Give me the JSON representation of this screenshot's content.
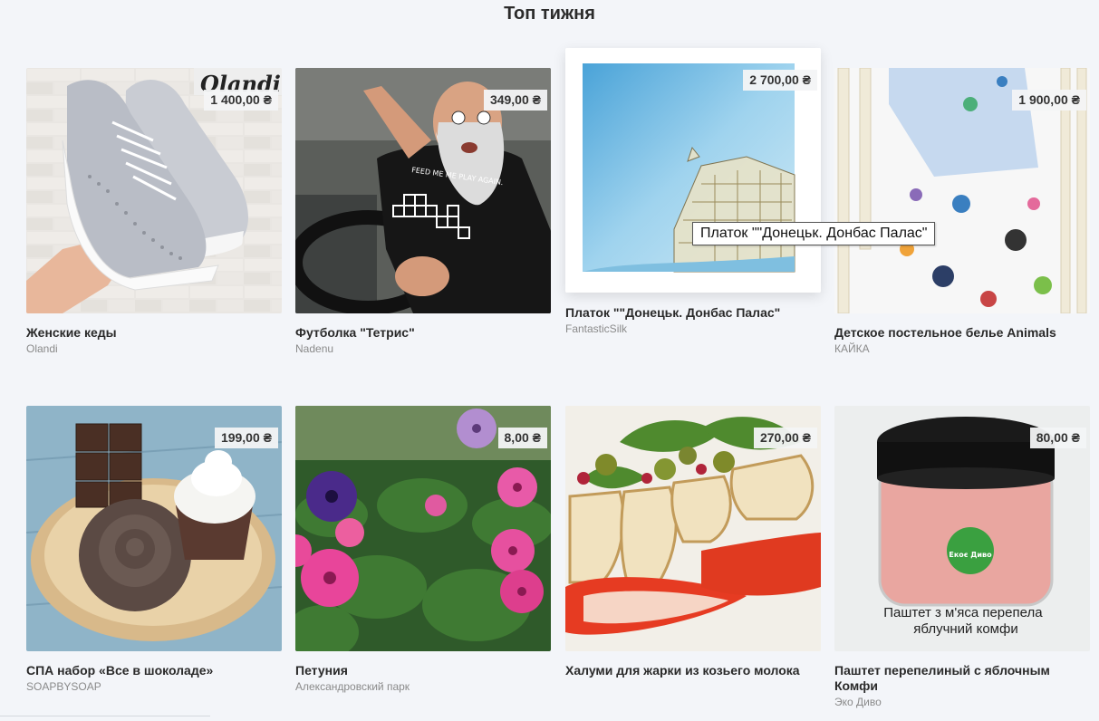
{
  "section": {
    "title": "Топ тижня"
  },
  "products": [
    {
      "title": "Женские кеды",
      "seller": "Olandi",
      "price": "1 400,00 ₴",
      "image_text": "Olandi"
    },
    {
      "title": "Футболка \"Тетрис\"",
      "seller": "Nadenu",
      "price": "349,00 ₴",
      "image_text": "FEED ME ME PLAY AGAIN."
    },
    {
      "title": "Платок  \"\"Донецьк. Донбас Палас\"",
      "seller": "FantasticSilk",
      "price": "2 700,00 ₴"
    },
    {
      "title": "Детское постельное белье Animals",
      "seller": "КАЙКА",
      "price": "1 900,00 ₴"
    },
    {
      "title": "СПА набор «Все в шоколаде»",
      "seller": "SOAPBYSOAP",
      "price": "199,00 ₴"
    },
    {
      "title": "Петуния",
      "seller": "Александровский парк",
      "price": "8,00 ₴"
    },
    {
      "title": "Халуми для жарки из козьего молока",
      "seller": "",
      "price": "270,00 ₴"
    },
    {
      "title": "Паштет перепелиный с яблочным Комфи",
      "seller": "Эко Диво",
      "price": "80,00 ₴",
      "image_text": "Паштет з м'яса перепела яблучний комфи",
      "badge_text": "Екоє Диво"
    }
  ],
  "tooltip": {
    "text": "Платок  \"\"Донецьк. Донбас Палас\""
  }
}
